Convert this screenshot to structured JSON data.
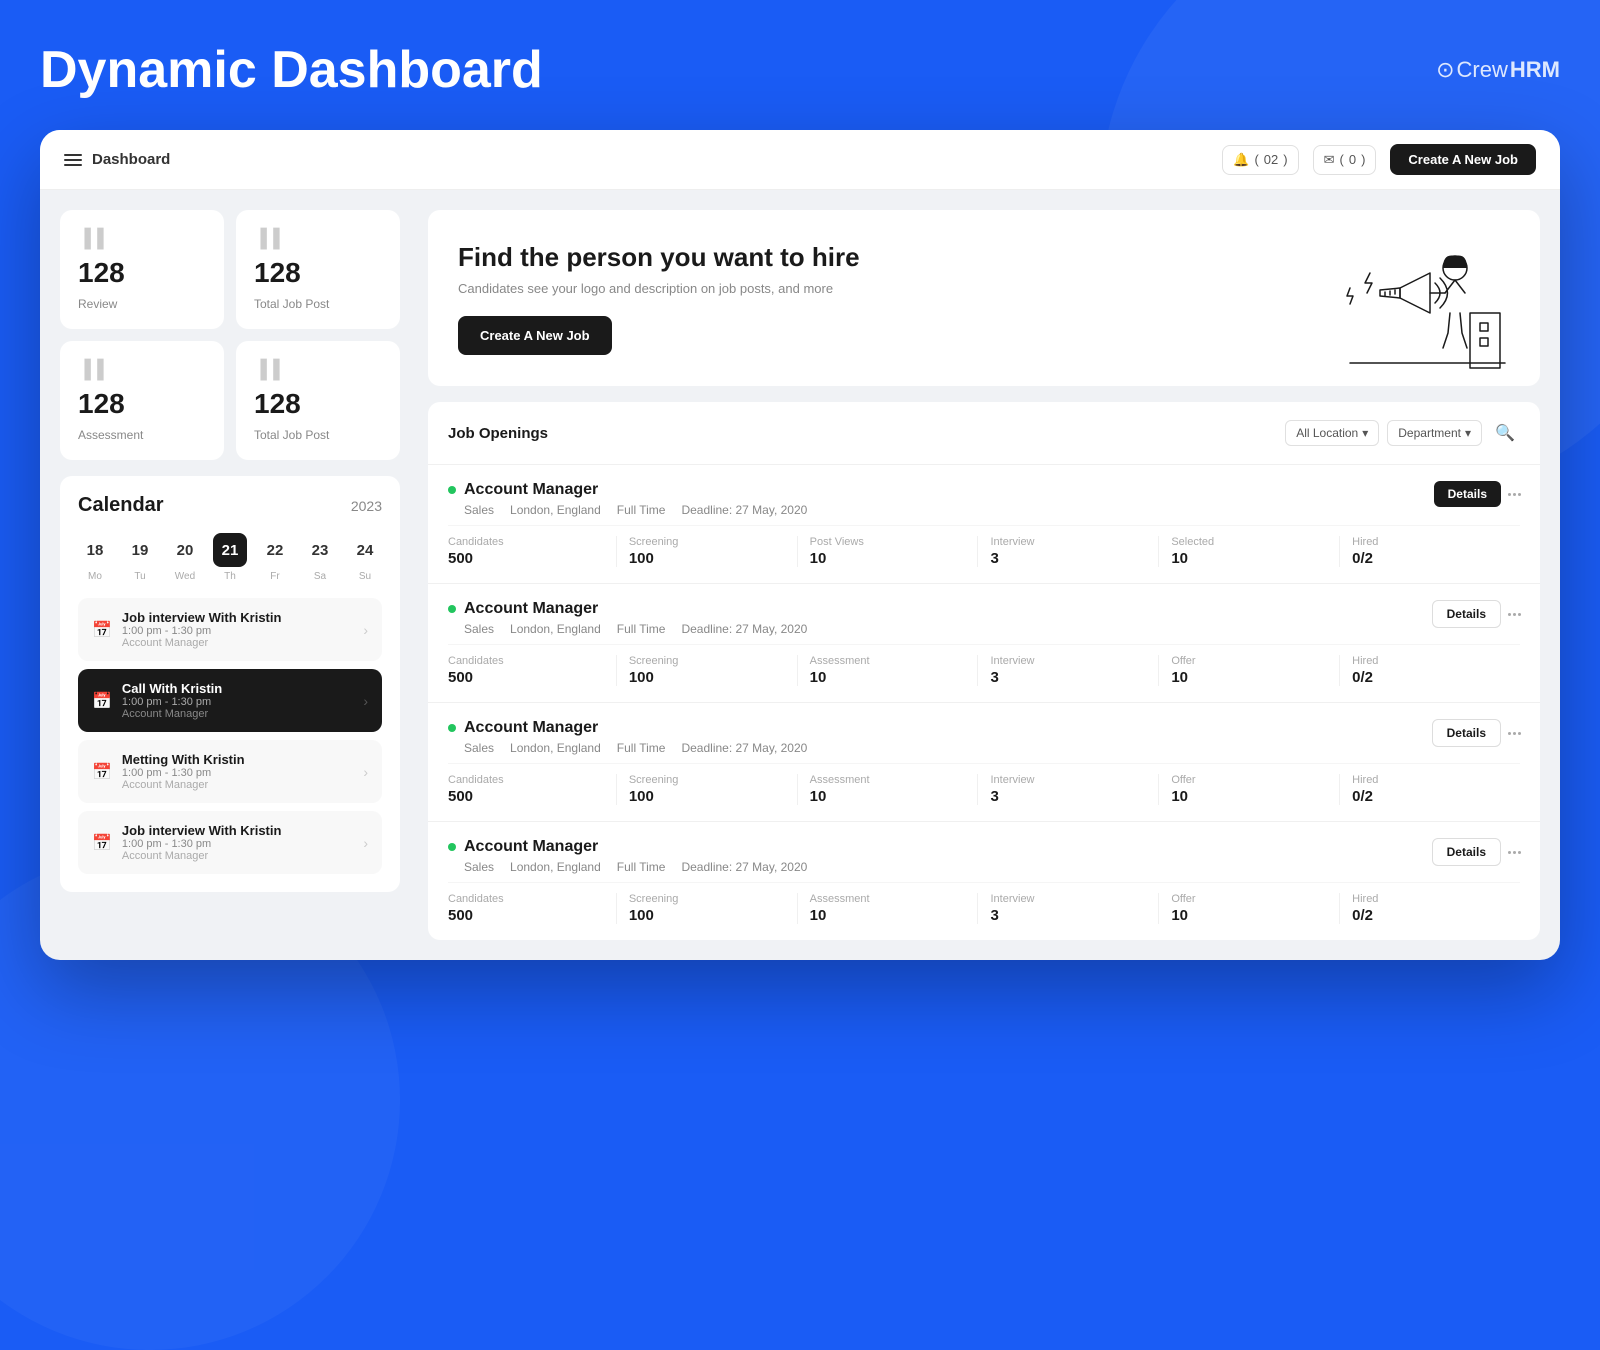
{
  "page": {
    "title": "Dynamic Dashboard",
    "logo": {
      "crew": "Crew",
      "hrm": "HRM",
      "icon": "⊙"
    }
  },
  "topnav": {
    "menu_label": "Dashboard",
    "notifications": {
      "bell_label": "02",
      "mail_label": "0"
    },
    "create_btn": "Create A New Job"
  },
  "stats": [
    {
      "icon": "❞",
      "value": "128",
      "label": "Review"
    },
    {
      "icon": "❞",
      "value": "128",
      "label": "Total Job Post"
    },
    {
      "icon": "❞",
      "value": "128",
      "label": "Assessment"
    },
    {
      "icon": "❞",
      "value": "128",
      "label": "Total Job Post"
    }
  ],
  "calendar": {
    "title": "Calendar",
    "year": "2023",
    "days": [
      {
        "num": "18",
        "label": "Mo",
        "active": false
      },
      {
        "num": "19",
        "label": "Tu",
        "active": false
      },
      {
        "num": "20",
        "label": "Wed",
        "active": false
      },
      {
        "num": "21",
        "label": "Th",
        "active": true
      },
      {
        "num": "22",
        "label": "Fr",
        "active": false
      },
      {
        "num": "23",
        "label": "Sa",
        "active": false
      },
      {
        "num": "24",
        "label": "Su",
        "active": false
      }
    ],
    "events": [
      {
        "id": "evt1",
        "title": "Job interview With Kristin",
        "time": "1:00 pm - 1:30 pm",
        "dept": "Account Manager",
        "dark": false
      },
      {
        "id": "evt2",
        "title": "Call With Kristin",
        "time": "1:00 pm - 1:30 pm",
        "dept": "Account Manager",
        "dark": true
      },
      {
        "id": "evt3",
        "title": "Metting With Kristin",
        "time": "1:00 pm - 1:30 pm",
        "dept": "Account Manager",
        "dark": false
      },
      {
        "id": "evt4",
        "title": "Job interview With Kristin",
        "time": "1:00 pm - 1:30 pm",
        "dept": "Account Manager",
        "dark": false
      }
    ]
  },
  "hero": {
    "heading": "Find the person you want to hire",
    "subtext": "Candidates see your logo and description on job posts, and more",
    "cta_btn": "Create A New Job"
  },
  "job_openings": {
    "section_title": "Job Openings",
    "filters": {
      "location_label": "All Location",
      "department_label": "Department"
    },
    "jobs": [
      {
        "id": "job1",
        "title": "Account Manager",
        "department": "Sales",
        "location": "London, England",
        "type": "Full Time",
        "deadline": "Deadline: 27 May, 2020",
        "active": true,
        "details_btn": "Details",
        "details_outline": false,
        "stats": [
          {
            "label": "Candidates",
            "value": "500"
          },
          {
            "label": "Screening",
            "value": "100"
          },
          {
            "label": "Post Views",
            "value": "10"
          },
          {
            "label": "Interview",
            "value": "3"
          },
          {
            "label": "Selected",
            "value": "10"
          },
          {
            "label": "Hired",
            "value": "0/2"
          }
        ]
      },
      {
        "id": "job2",
        "title": "Account Manager",
        "department": "Sales",
        "location": "London, England",
        "type": "Full Time",
        "deadline": "Deadline: 27 May, 2020",
        "active": true,
        "details_btn": "Details",
        "details_outline": true,
        "stats": [
          {
            "label": "Candidates",
            "value": "500"
          },
          {
            "label": "Screening",
            "value": "100"
          },
          {
            "label": "Assessment",
            "value": "10"
          },
          {
            "label": "Interview",
            "value": "3"
          },
          {
            "label": "Offer",
            "value": "10"
          },
          {
            "label": "Hired",
            "value": "0/2"
          }
        ]
      },
      {
        "id": "job3",
        "title": "Account Manager",
        "department": "Sales",
        "location": "London, England",
        "type": "Full Time",
        "deadline": "Deadline: 27 May, 2020",
        "active": true,
        "details_btn": "Details",
        "details_outline": true,
        "stats": [
          {
            "label": "Candidates",
            "value": "500"
          },
          {
            "label": "Screening",
            "value": "100"
          },
          {
            "label": "Assessment",
            "value": "10"
          },
          {
            "label": "Interview",
            "value": "3"
          },
          {
            "label": "Offer",
            "value": "10"
          },
          {
            "label": "Hired",
            "value": "0/2"
          }
        ]
      },
      {
        "id": "job4",
        "title": "Account Manager",
        "department": "Sales",
        "location": "London, England",
        "type": "Full Time",
        "deadline": "Deadline: 27 May, 2020",
        "active": true,
        "details_btn": "Details",
        "details_outline": true,
        "stats": [
          {
            "label": "Candidates",
            "value": "500"
          },
          {
            "label": "Screening",
            "value": "100"
          },
          {
            "label": "Assessment",
            "value": "10"
          },
          {
            "label": "Interview",
            "value": "3"
          },
          {
            "label": "Offer",
            "value": "10"
          },
          {
            "label": "Hired",
            "value": "0/2"
          }
        ]
      }
    ]
  }
}
